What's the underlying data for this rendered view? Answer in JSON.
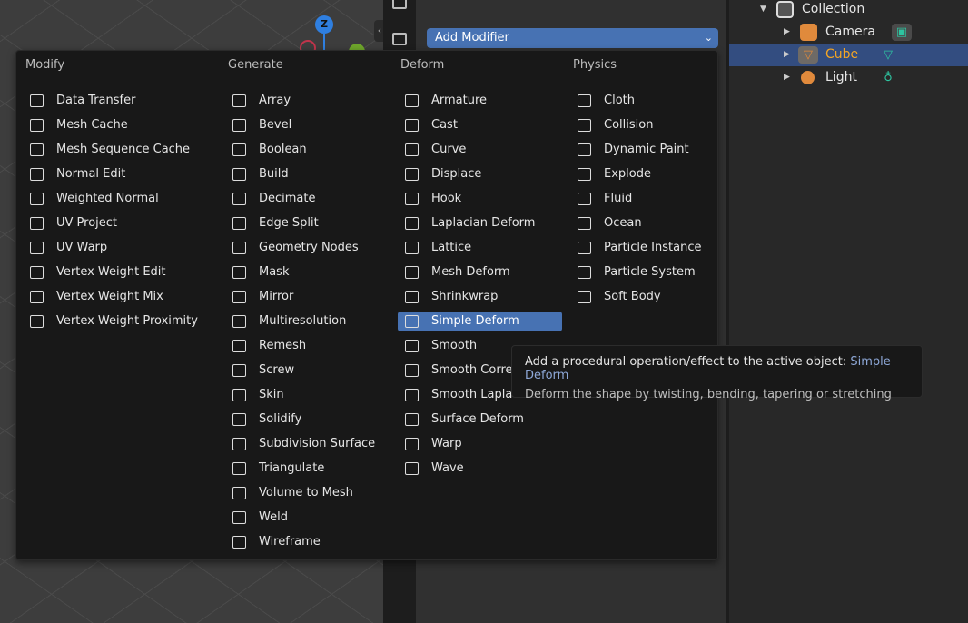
{
  "viewport": {
    "gizmo_z": "Z"
  },
  "properties": {
    "add_modifier": "Add Modifier",
    "chevron": "⌄"
  },
  "outliner": {
    "rows": [
      {
        "label": "Collection",
        "icon": "collection-icon"
      },
      {
        "label": "Camera",
        "icon": "camera-icon",
        "data_icon": "camera-data-icon"
      },
      {
        "label": "Cube",
        "icon": "mesh-icon",
        "data_icon": "mesh-data-icon",
        "selected": true
      },
      {
        "label": "Light",
        "icon": "light-icon",
        "data_icon": "light-data-icon"
      }
    ]
  },
  "menu": {
    "columns": [
      {
        "title": "Modify",
        "items": [
          "Data Transfer",
          "Mesh Cache",
          "Mesh Sequence Cache",
          "Normal Edit",
          "Weighted Normal",
          "UV Project",
          "UV Warp",
          "Vertex Weight Edit",
          "Vertex Weight Mix",
          "Vertex Weight Proximity"
        ]
      },
      {
        "title": "Generate",
        "items": [
          "Array",
          "Bevel",
          "Boolean",
          "Build",
          "Decimate",
          "Edge Split",
          "Geometry Nodes",
          "Mask",
          "Mirror",
          "Multiresolution",
          "Remesh",
          "Screw",
          "Skin",
          "Solidify",
          "Subdivision Surface",
          "Triangulate",
          "Volume to Mesh",
          "Weld",
          "Wireframe"
        ]
      },
      {
        "title": "Deform",
        "items": [
          "Armature",
          "Cast",
          "Curve",
          "Displace",
          "Hook",
          "Laplacian Deform",
          "Lattice",
          "Mesh Deform",
          "Shrinkwrap",
          "Simple Deform",
          "Smooth",
          "Smooth Correc",
          "Smooth Laplac",
          "Surface Deform",
          "Warp",
          "Wave"
        ]
      },
      {
        "title": "Physics",
        "items": [
          "Cloth",
          "Collision",
          "Dynamic Paint",
          "Explode",
          "Fluid",
          "Ocean",
          "Particle Instance",
          "Particle System",
          "Soft Body"
        ]
      }
    ],
    "active_item": "Simple Deform"
  },
  "tooltip": {
    "prefix": "Add a procedural operation/effect to the active object: ",
    "highlight": "Simple Deform",
    "description": "Deform the shape by twisting, bending, tapering or stretching"
  },
  "colors": {
    "accent": "#4772b3",
    "selected_row": "#334d80",
    "active_text": "#f5a623",
    "data_icon": "#2ec4a0"
  }
}
